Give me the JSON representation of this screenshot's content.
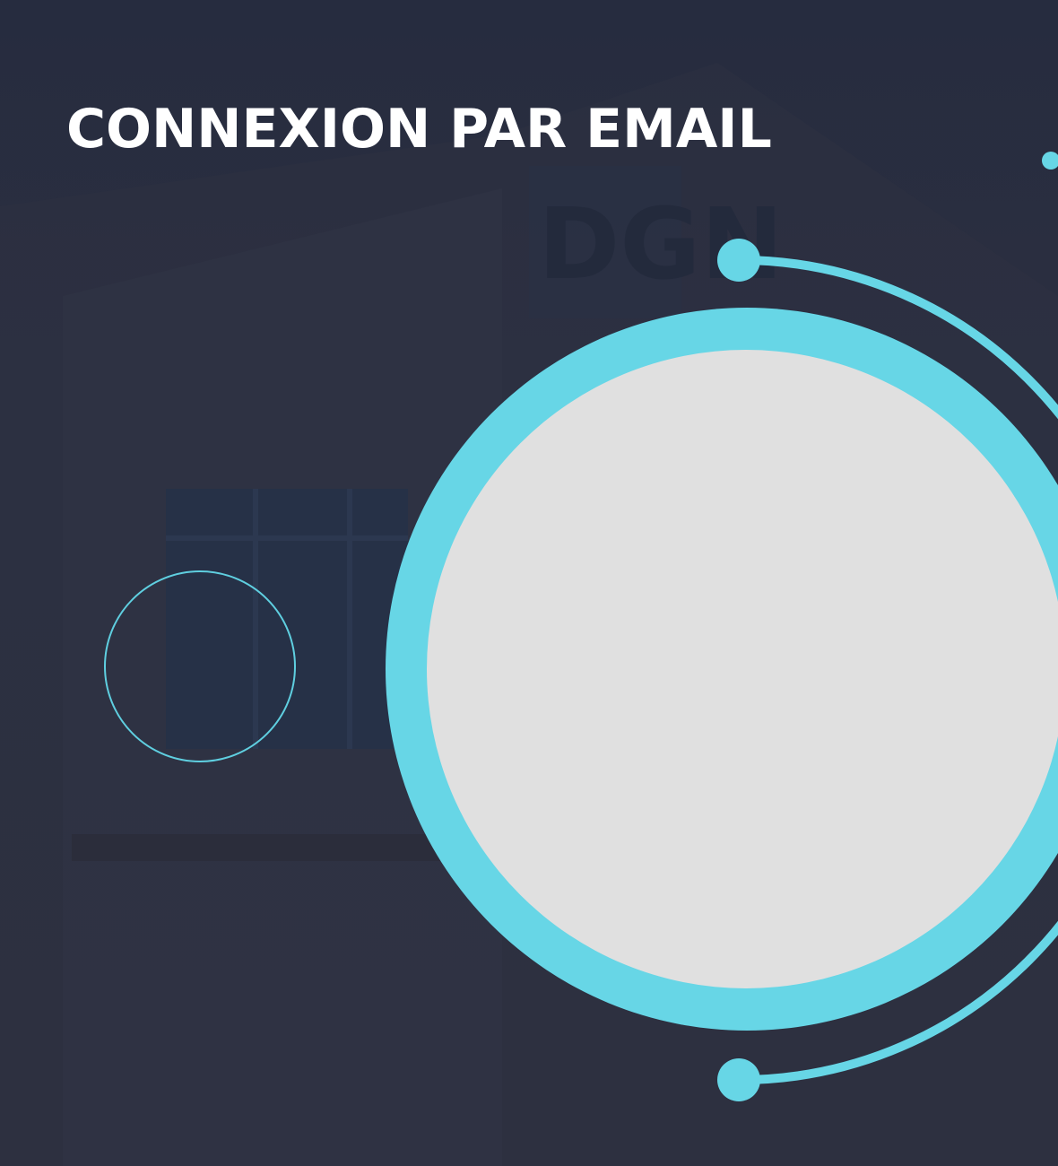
{
  "header": {
    "title": "CONNEXION PAR EMAIL"
  },
  "background": {
    "sign_text": "DGN"
  },
  "colors": {
    "accent": "#67d6e6",
    "background": "#2b2f40",
    "placeholder": "#e0e0e0",
    "title": "#ffffff"
  },
  "icons": {
    "avatar": "user-avatar-placeholder",
    "decorative_ring": "circle-outline"
  }
}
